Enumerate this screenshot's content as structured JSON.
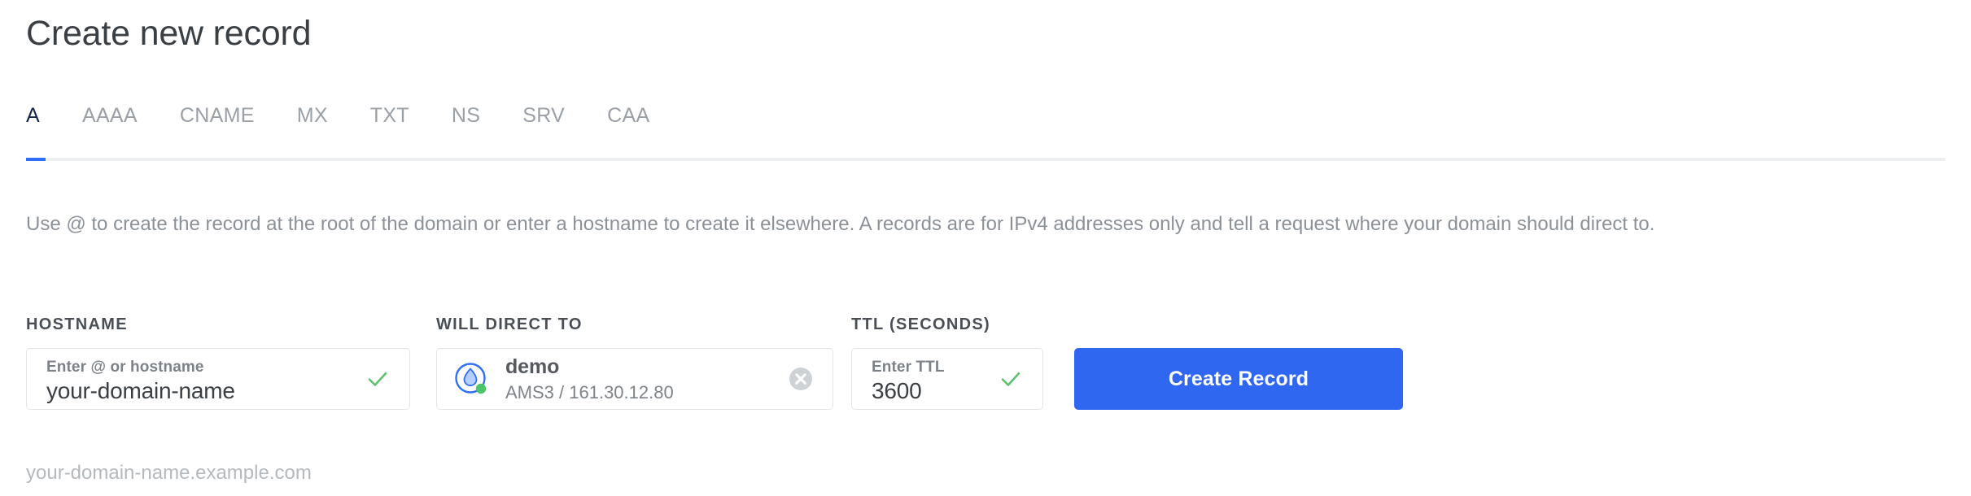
{
  "header": {
    "title": "Create new record"
  },
  "tabs": {
    "active_index": 0,
    "items": [
      {
        "label": "A"
      },
      {
        "label": "AAAA"
      },
      {
        "label": "CNAME"
      },
      {
        "label": "MX"
      },
      {
        "label": "TXT"
      },
      {
        "label": "NS"
      },
      {
        "label": "SRV"
      },
      {
        "label": "CAA"
      }
    ]
  },
  "description": "Use @ to create the record at the root of the domain or enter a hostname to create it elsewhere. A records are for IPv4 addresses only and tell a request where your domain should direct to.",
  "form": {
    "hostname": {
      "label": "HOSTNAME",
      "placeholder": "Enter @ or hostname",
      "value": "your-domain-name",
      "helper": "your-domain-name.example.com",
      "valid_icon": "check-icon"
    },
    "will_direct_to": {
      "label": "WILL DIRECT TO",
      "droplet_name": "demo",
      "droplet_details": "AMS3 / 161.30.12.80",
      "resource_icon": "droplet-icon",
      "status": "active",
      "clear_icon": "clear-icon"
    },
    "ttl": {
      "label": "TTL (SECONDS)",
      "placeholder": "Enter TTL",
      "value": "3600",
      "valid_icon": "check-icon"
    },
    "submit": {
      "label": "Create Record"
    }
  },
  "colors": {
    "accent_blue": "#3067f0",
    "tab_active": "#14264c",
    "tab_inactive": "#9aa0a6",
    "valid_green": "#5cc06a",
    "status_green": "#4cc46a",
    "droplet_blue": "#2f6ef5",
    "border": "#e2e5e8",
    "muted_text": "#8b9197"
  }
}
